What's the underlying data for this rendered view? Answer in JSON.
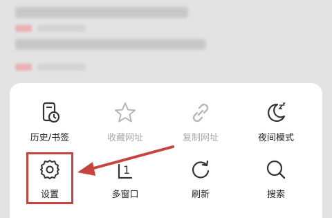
{
  "menu": {
    "items": [
      {
        "label": "历史/书签",
        "icon": "history-bookmark-icon",
        "enabled": true
      },
      {
        "label": "收藏网址",
        "icon": "star-icon",
        "enabled": false
      },
      {
        "label": "复制网址",
        "icon": "link-icon",
        "enabled": false
      },
      {
        "label": "夜间模式",
        "icon": "night-mode-icon",
        "enabled": true
      },
      {
        "label": "设置",
        "icon": "gear-icon",
        "enabled": true
      },
      {
        "label": "多窗口",
        "icon": "multi-window-icon",
        "enabled": true,
        "count": "1"
      },
      {
        "label": "刷新",
        "icon": "refresh-icon",
        "enabled": true
      },
      {
        "label": "搜索",
        "icon": "search-icon",
        "enabled": true
      }
    ]
  },
  "colors": {
    "annotation": "#c8433e",
    "icon_active": "#333333",
    "icon_disabled": "#b5b5b5"
  }
}
